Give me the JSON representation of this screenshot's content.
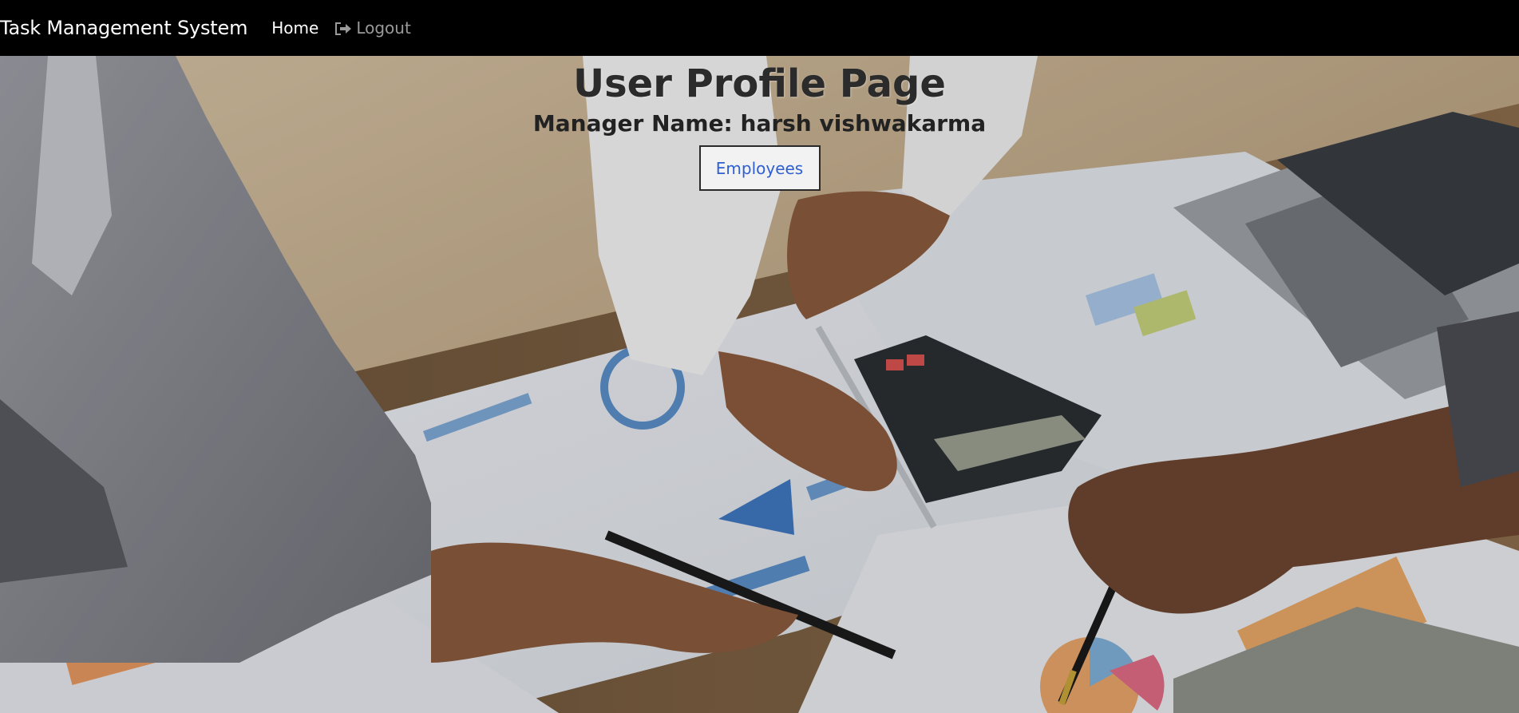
{
  "navbar": {
    "brand": "Task Management System",
    "home_label": "Home",
    "logout_label": "Logout",
    "logout_icon": "sign-out-icon",
    "background_color": "#000000"
  },
  "main": {
    "title": "User Profile Page",
    "manager_line": "Manager Name: harsh vishwakarma",
    "employees_button": "Employees",
    "background_image": "office-desk-meeting-photo"
  },
  "colors": {
    "button_text": "#2f5fd0",
    "title_text": "#2b2b2b"
  }
}
